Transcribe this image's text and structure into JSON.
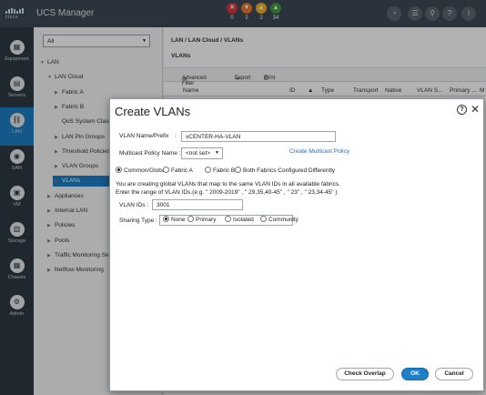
{
  "app": {
    "logo_text": "cisco",
    "title": "UCS Manager"
  },
  "faults": [
    {
      "glyph": "✕",
      "count": "0",
      "color": "#d8343a"
    },
    {
      "glyph": "▼",
      "count": "2",
      "color": "#e9782b"
    },
    {
      "glyph": "▲",
      "count": "2",
      "color": "#f0b429"
    },
    {
      "glyph": "▲",
      "count": "34",
      "color": "#3f9b45"
    }
  ],
  "topicons": [
    {
      "name": "status-icon",
      "glyph": "◔"
    },
    {
      "name": "menu-icon",
      "glyph": "☰"
    },
    {
      "name": "search-icon",
      "glyph": "⚲"
    },
    {
      "name": "help-icon",
      "glyph": "?"
    },
    {
      "name": "info-icon",
      "glyph": "i"
    }
  ],
  "nav": [
    {
      "name": "equipment",
      "label": "Equipment",
      "glyph": "▦"
    },
    {
      "name": "servers",
      "label": "Servers",
      "glyph": "▤"
    },
    {
      "name": "lan",
      "label": "LAN",
      "glyph": "⛓"
    },
    {
      "name": "san",
      "label": "SAN",
      "glyph": "◉"
    },
    {
      "name": "vm",
      "label": "VM",
      "glyph": "▣"
    },
    {
      "name": "storage",
      "label": "Storage",
      "glyph": "▥"
    },
    {
      "name": "chassis",
      "label": "Chassis",
      "glyph": "▦"
    },
    {
      "name": "admin",
      "label": "Admin",
      "glyph": "⚙"
    }
  ],
  "tree": {
    "filter": "All",
    "items": [
      {
        "label": "LAN",
        "indent": 0,
        "arrow": "▼",
        "sel": false
      },
      {
        "label": "LAN Cloud",
        "indent": 1,
        "arrow": "▼",
        "sel": false
      },
      {
        "label": "Fabric A",
        "indent": 2,
        "arrow": "▶",
        "sel": false
      },
      {
        "label": "Fabric B",
        "indent": 2,
        "arrow": "▶",
        "sel": false
      },
      {
        "label": "QoS System Class",
        "indent": 2,
        "arrow": "",
        "sel": false
      },
      {
        "label": "LAN Pin Groups",
        "indent": 2,
        "arrow": "▶",
        "sel": false
      },
      {
        "label": "Threshold Policies",
        "indent": 2,
        "arrow": "▶",
        "sel": false
      },
      {
        "label": "VLAN Groups",
        "indent": 2,
        "arrow": "▶",
        "sel": false
      },
      {
        "label": "VLANs",
        "indent": 2,
        "arrow": "▶",
        "sel": true
      },
      {
        "label": "Appliances",
        "indent": 1,
        "arrow": "▶",
        "sel": false
      },
      {
        "label": "Internal LAN",
        "indent": 1,
        "arrow": "▶",
        "sel": false
      },
      {
        "label": "Policies",
        "indent": 1,
        "arrow": "▶",
        "sel": false
      },
      {
        "label": "Pools",
        "indent": 1,
        "arrow": "▶",
        "sel": false
      },
      {
        "label": "Traffic Monitoring Sess",
        "indent": 1,
        "arrow": "▶",
        "sel": false
      },
      {
        "label": "Netflow Monitoring",
        "indent": 1,
        "arrow": "▶",
        "sel": false
      }
    ]
  },
  "main": {
    "breadcrumb": "LAN / LAN Cloud / VLANs",
    "section_title": "VLANs",
    "toolbar": [
      "Advanced Filter",
      "Export",
      "Print"
    ],
    "columns": [
      "Name",
      "ID",
      "Type",
      "Transport",
      "Native",
      "VLAN S...",
      "Primary ...",
      "M"
    ]
  },
  "dialog": {
    "title": "Create VLANs",
    "help": "?",
    "close": "✕",
    "name_label": "VLAN Name/Prefix",
    "name_colon": ":",
    "name_value": "vCENTER-HA-VLAN",
    "mcast_label": "Multicast Policy Name :",
    "mcast_value": "<not set>",
    "mcast_link": "Create Multicast Policy",
    "scope_options": [
      {
        "label": "Common/Global",
        "checked": true
      },
      {
        "label": "Fabric A",
        "checked": false
      },
      {
        "label": "Fabric B",
        "checked": false
      },
      {
        "label": "Both Fabrics Configured Differently",
        "checked": false
      }
    ],
    "info_line1": "You are creating global VLANs that map to the same VLAN IDs in all available fabrics.",
    "info_line2": "Enter the range of VLAN IDs.(e.g. \" 2009-2019\" , \" 29,35,40-45\" , \" 23\" , \" 23,34-45\" )",
    "ids_label": "VLAN IDs :",
    "ids_value": "3001",
    "sharing_label": "Sharing Type :",
    "sharing_options": [
      {
        "label": "None",
        "checked": true
      },
      {
        "label": "Primary",
        "checked": false
      },
      {
        "label": "Isolated",
        "checked": false
      },
      {
        "label": "Community",
        "checked": false
      }
    ],
    "btn_check": "Check Overlap",
    "btn_ok": "OK",
    "btn_cancel": "Cancel"
  }
}
